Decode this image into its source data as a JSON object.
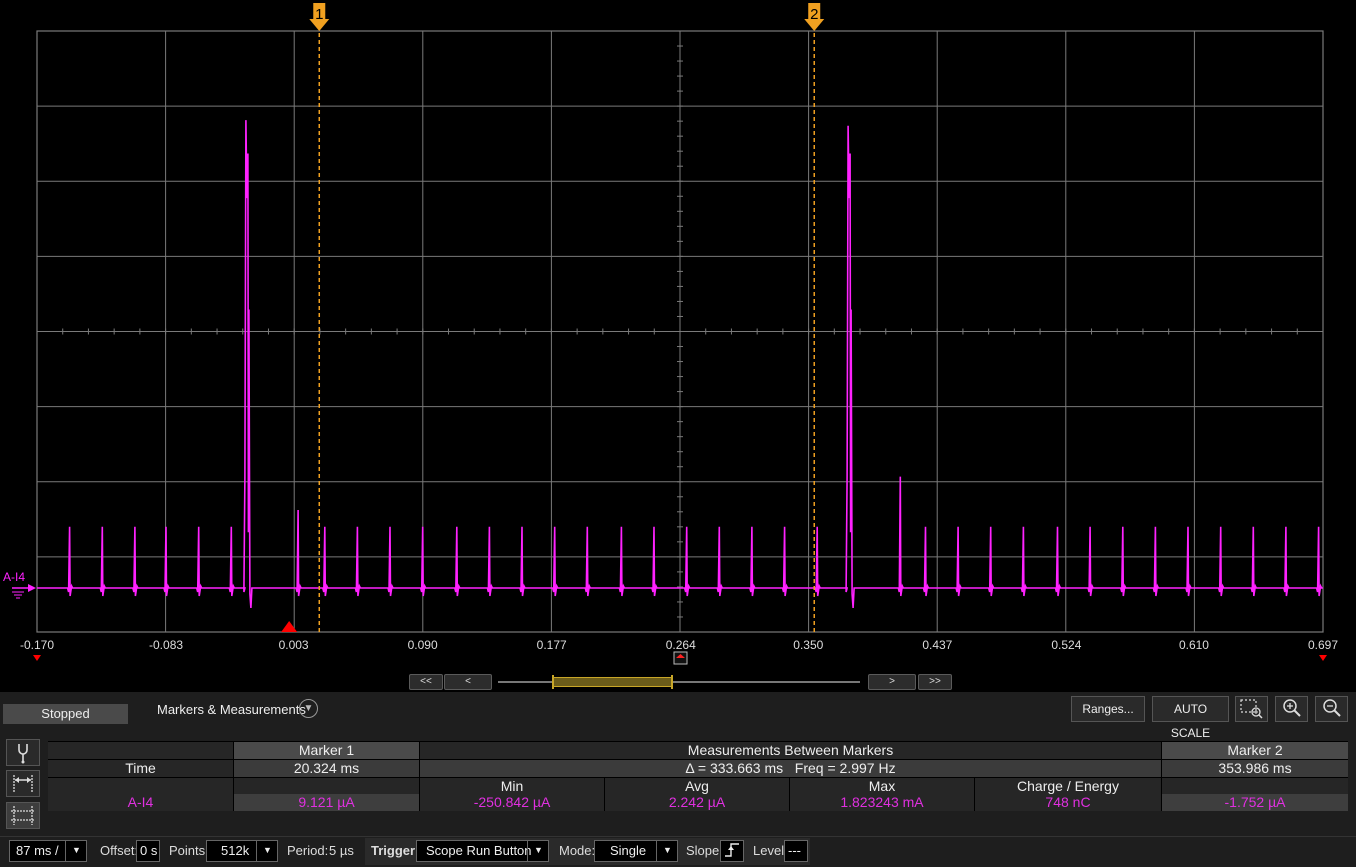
{
  "chart_data": {
    "type": "line",
    "series": [
      {
        "name": "A-I4"
      }
    ],
    "x": [
      -0.17,
      -0.083,
      0.003,
      0.09,
      0.177,
      0.264,
      0.35,
      0.437,
      0.524,
      0.61,
      0.697
    ],
    "xlim": [
      -0.17,
      0.697
    ],
    "x_tick_labels": [
      "-0.170",
      "-0.083",
      "0.003",
      "0.090",
      "0.177",
      "0.264",
      "0.350",
      "0.437",
      "0.524",
      "0.610",
      "0.697"
    ],
    "grid": true,
    "background": "#000000",
    "colors": {
      "trace": "#ff22ff",
      "grid": "#7a7a7a",
      "marker": "#f0a020",
      "trigger": "#ff0000"
    },
    "markers": [
      {
        "label": "1",
        "time_s": 0.0203
      },
      {
        "label": "2",
        "time_s": 0.354
      }
    ],
    "trigger_time_s": 0.0,
    "pulses_large": [
      {
        "time_s": -0.0285,
        "peak": 0.84
      },
      {
        "time_s": 0.3775,
        "peak": 0.83
      }
    ],
    "spikes": [
      {
        "time_s": -0.148,
        "h": 0.11
      },
      {
        "time_s": -0.126,
        "h": 0.11
      },
      {
        "time_s": -0.104,
        "h": 0.11
      },
      {
        "time_s": -0.083,
        "h": 0.11
      },
      {
        "time_s": -0.061,
        "h": 0.11
      },
      {
        "time_s": -0.039,
        "h": 0.11
      },
      {
        "time_s": 0.006,
        "h": 0.14
      },
      {
        "time_s": 0.024,
        "h": 0.11
      },
      {
        "time_s": 0.046,
        "h": 0.11
      },
      {
        "time_s": 0.068,
        "h": 0.11
      },
      {
        "time_s": 0.09,
        "h": 0.11
      },
      {
        "time_s": 0.113,
        "h": 0.11
      },
      {
        "time_s": 0.135,
        "h": 0.11
      },
      {
        "time_s": 0.157,
        "h": 0.11
      },
      {
        "time_s": 0.179,
        "h": 0.11
      },
      {
        "time_s": 0.201,
        "h": 0.11
      },
      {
        "time_s": 0.224,
        "h": 0.11
      },
      {
        "time_s": 0.246,
        "h": 0.11
      },
      {
        "time_s": 0.268,
        "h": 0.11
      },
      {
        "time_s": 0.29,
        "h": 0.11
      },
      {
        "time_s": 0.312,
        "h": 0.11
      },
      {
        "time_s": 0.334,
        "h": 0.11
      },
      {
        "time_s": 0.356,
        "h": 0.11
      },
      {
        "time_s": 0.412,
        "h": 0.2
      },
      {
        "time_s": 0.429,
        "h": 0.11
      },
      {
        "time_s": 0.451,
        "h": 0.11
      },
      {
        "time_s": 0.473,
        "h": 0.11
      },
      {
        "time_s": 0.495,
        "h": 0.11
      },
      {
        "time_s": 0.518,
        "h": 0.11
      },
      {
        "time_s": 0.54,
        "h": 0.11
      },
      {
        "time_s": 0.562,
        "h": 0.11
      },
      {
        "time_s": 0.584,
        "h": 0.11
      },
      {
        "time_s": 0.606,
        "h": 0.11
      },
      {
        "time_s": 0.628,
        "h": 0.11
      },
      {
        "time_s": 0.65,
        "h": 0.11
      },
      {
        "time_s": 0.672,
        "h": 0.11
      },
      {
        "time_s": 0.694,
        "h": 0.11
      }
    ]
  },
  "channel_label": "A-I4",
  "status": "Stopped",
  "panel": {
    "title": "Markers & Measurements",
    "toolbar": {
      "ranges": "Ranges...",
      "auto_scale": "AUTO SCALE"
    }
  },
  "measurements": {
    "row_time_label": "Time",
    "row_channel_label": "A-I4",
    "marker1": {
      "header": "Marker 1",
      "time": "20.324 ms",
      "value": "9.121 µA"
    },
    "marker2": {
      "header": "Marker 2",
      "time": "353.986 ms",
      "value": "-1.752 µA"
    },
    "between": {
      "header": "Measurements Between Markers",
      "delta": "Δ = 333.663 ms",
      "freq": "Freq = 2.997 Hz",
      "col_min": "Min",
      "col_avg": "Avg",
      "col_max": "Max",
      "col_charge": "Charge / Energy",
      "min": "-250.842 µA",
      "avg": "2.242 µA",
      "max": "1.823243 mA",
      "charge": "748 nC"
    }
  },
  "bottom_bar": {
    "timebase": "87 ms /",
    "offset_label": "Offset:",
    "offset_value": "0 s",
    "points_label": "Points:",
    "points_value": "512k",
    "period_label": "Period:",
    "period_value": "5 µs",
    "trigger_label": "Trigger",
    "trigger_source": "Scope Run Button",
    "mode_label": "Mode:",
    "mode_value": "Single",
    "slope_label": "Slope:",
    "level_label": "Level:",
    "level_value": "---"
  },
  "nav": {
    "first": "<<",
    "prev": "<",
    "next": ">",
    "last": ">>"
  }
}
